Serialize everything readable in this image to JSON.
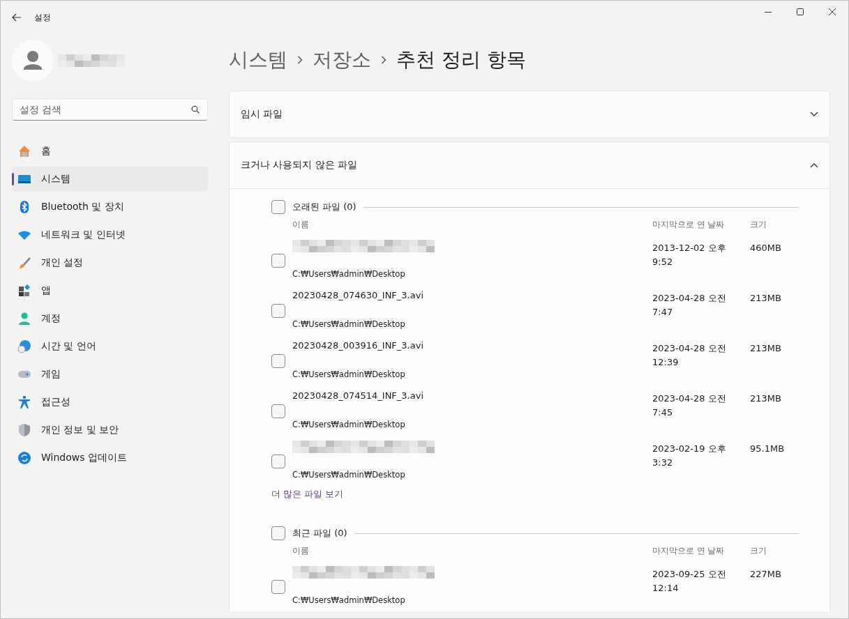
{
  "window": {
    "title": "설정"
  },
  "profile": {
    "name_blurred": true
  },
  "search": {
    "placeholder": "설정 검색"
  },
  "nav": [
    {
      "label": "홈",
      "selected": false
    },
    {
      "label": "시스템",
      "selected": true
    },
    {
      "label": "Bluetooth 및 장치",
      "selected": false
    },
    {
      "label": "네트워크 및 인터넷",
      "selected": false
    },
    {
      "label": "개인 설정",
      "selected": false
    },
    {
      "label": "앱",
      "selected": false
    },
    {
      "label": "계정",
      "selected": false
    },
    {
      "label": "시간 및 언어",
      "selected": false
    },
    {
      "label": "게임",
      "selected": false
    },
    {
      "label": "접근성",
      "selected": false
    },
    {
      "label": "개인 정보 및 보안",
      "selected": false
    },
    {
      "label": "Windows 업데이트",
      "selected": false
    }
  ],
  "breadcrumb": [
    "시스템",
    "저장소",
    "추천 정리 항목"
  ],
  "sections": [
    {
      "title": "임시 파일",
      "expanded": false
    },
    {
      "title": "크거나 사용되지 않은 파일",
      "expanded": true,
      "groups": [
        {
          "title": "오래된 파일 (0)",
          "checked": false,
          "columns": [
            "이름",
            "마지막으로 연 날짜",
            "크기"
          ],
          "more_link": "더 많은 파일 보기",
          "files": [
            {
              "kind": "blurred",
              "path": "C:₩Users₩admin₩Desktop",
              "opened": [
                "2013-12-02 오후",
                "9:52"
              ],
              "size": "460MB",
              "checked": false
            },
            {
              "kind": "named",
              "name": "20230428_074630_INF_3.avi",
              "path": "C:₩Users₩admin₩Desktop",
              "opened": [
                "2023-04-28 오전",
                "7:47"
              ],
              "size": "213MB",
              "checked": false
            },
            {
              "kind": "named",
              "name": "20230428_003916_INF_3.avi",
              "path": "C:₩Users₩admin₩Desktop",
              "opened": [
                "2023-04-28 오전",
                "12:39"
              ],
              "size": "213MB",
              "checked": false
            },
            {
              "kind": "named",
              "name": "20230428_074514_INF_3.avi",
              "path": "C:₩Users₩admin₩Desktop",
              "opened": [
                "2023-04-28 오전",
                "7:45"
              ],
              "size": "213MB",
              "checked": false
            },
            {
              "kind": "blurred",
              "path": "C:₩Users₩admin₩Desktop",
              "opened": [
                "2023-02-19 오후",
                "3:32"
              ],
              "size": "95.1MB",
              "checked": false
            }
          ]
        },
        {
          "title": "최근 파일 (0)",
          "checked": false,
          "columns": [
            "이름",
            "마지막으로 연 날짜",
            "크기"
          ],
          "files": [
            {
              "kind": "blurred",
              "path": "C:₩Users₩admin₩Desktop",
              "opened": [
                "2023-09-25 오전",
                "12:14"
              ],
              "size": "227MB",
              "checked": false
            }
          ]
        }
      ]
    }
  ]
}
